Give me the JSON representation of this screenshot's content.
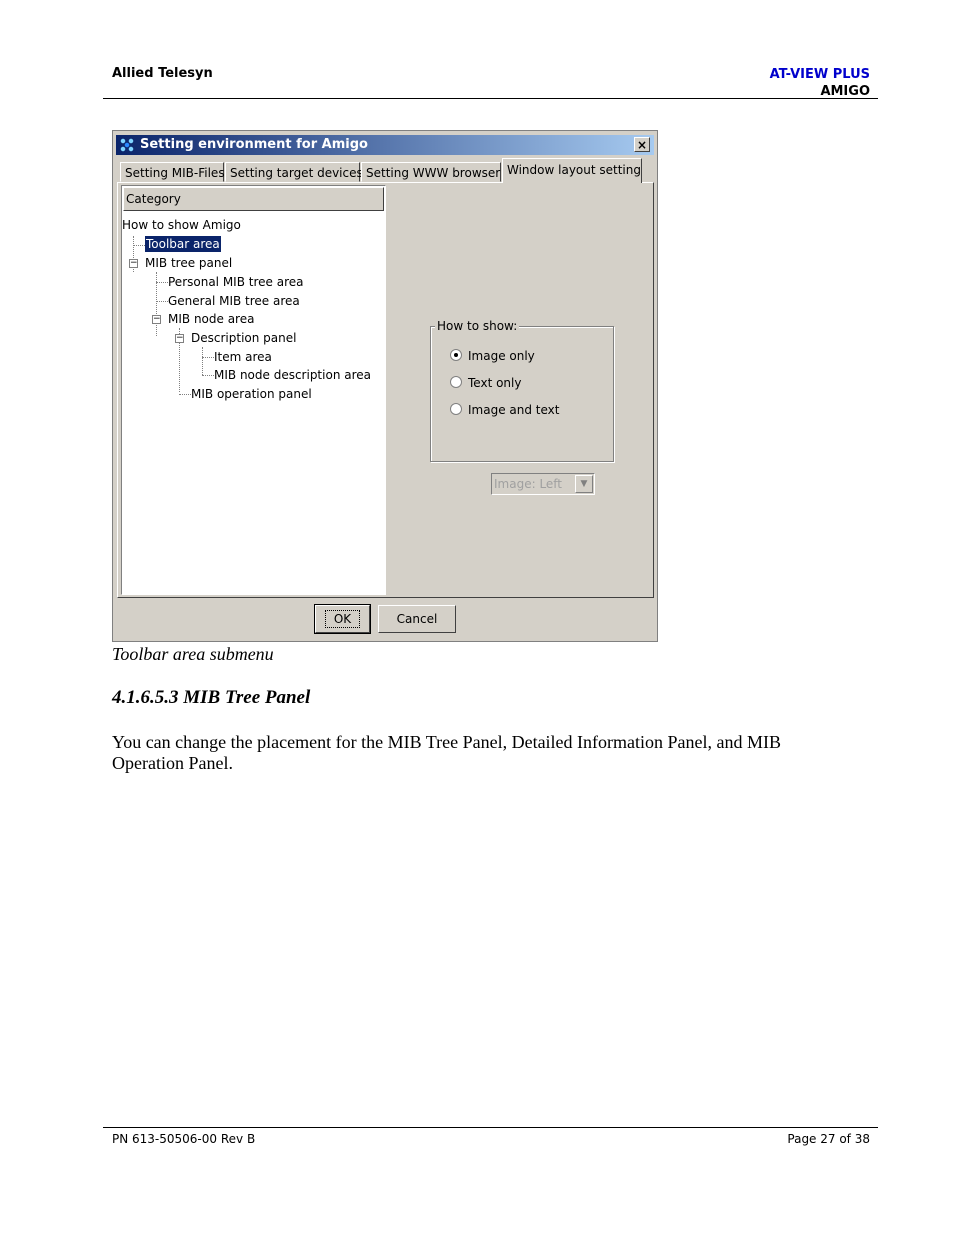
{
  "header": {
    "company": "Allied Telesyn",
    "product": "AT-VIEW PLUS",
    "module": "AMIGO",
    "product_color": "#0000cc"
  },
  "dialog": {
    "title": "Setting environment for Amigo",
    "close_glyph": "×",
    "tabs": [
      {
        "label": "Setting MIB-Files",
        "active": false
      },
      {
        "label": "Setting target devices",
        "active": false
      },
      {
        "label": "Setting WWW browser",
        "active": false
      },
      {
        "label": "Window layout setting",
        "active": true
      }
    ],
    "category_header": "Category",
    "tree": {
      "root": "How to show Amigo",
      "toolbar_area": "Toolbar area",
      "mib_tree_panel": "MIB tree panel",
      "personal_mib_tree_area": "Personal MIB tree area",
      "general_mib_tree_area": "General MIB tree area",
      "mib_node_area": "MIB node area",
      "description_panel": "Description panel",
      "item_area": "Item area",
      "mib_node_description_area": "MIB node description area",
      "mib_operation_panel": "MIB operation panel"
    },
    "how_to_show": {
      "label": "How to show:",
      "options": [
        {
          "label": "Image only",
          "checked": true
        },
        {
          "label": "Text only",
          "checked": false
        },
        {
          "label": "Image and text",
          "checked": false
        }
      ],
      "image_position": "Image: Left"
    },
    "ok_label": "OK",
    "cancel_label": "Cancel",
    "selection_color": "#0a246a",
    "title_gradient": [
      "#0a246a",
      "#a6caf0"
    ]
  },
  "caption": "Toolbar area submenu",
  "section_heading": "4.1.6.5.3 MIB Tree Panel",
  "paragraph": "You can change the placement for the MIB Tree Panel, Detailed Information Panel, and MIB Operation Panel.",
  "footer": {
    "part_number": "PN 613-50506-00 Rev B",
    "page": "Page 27 of 38"
  }
}
